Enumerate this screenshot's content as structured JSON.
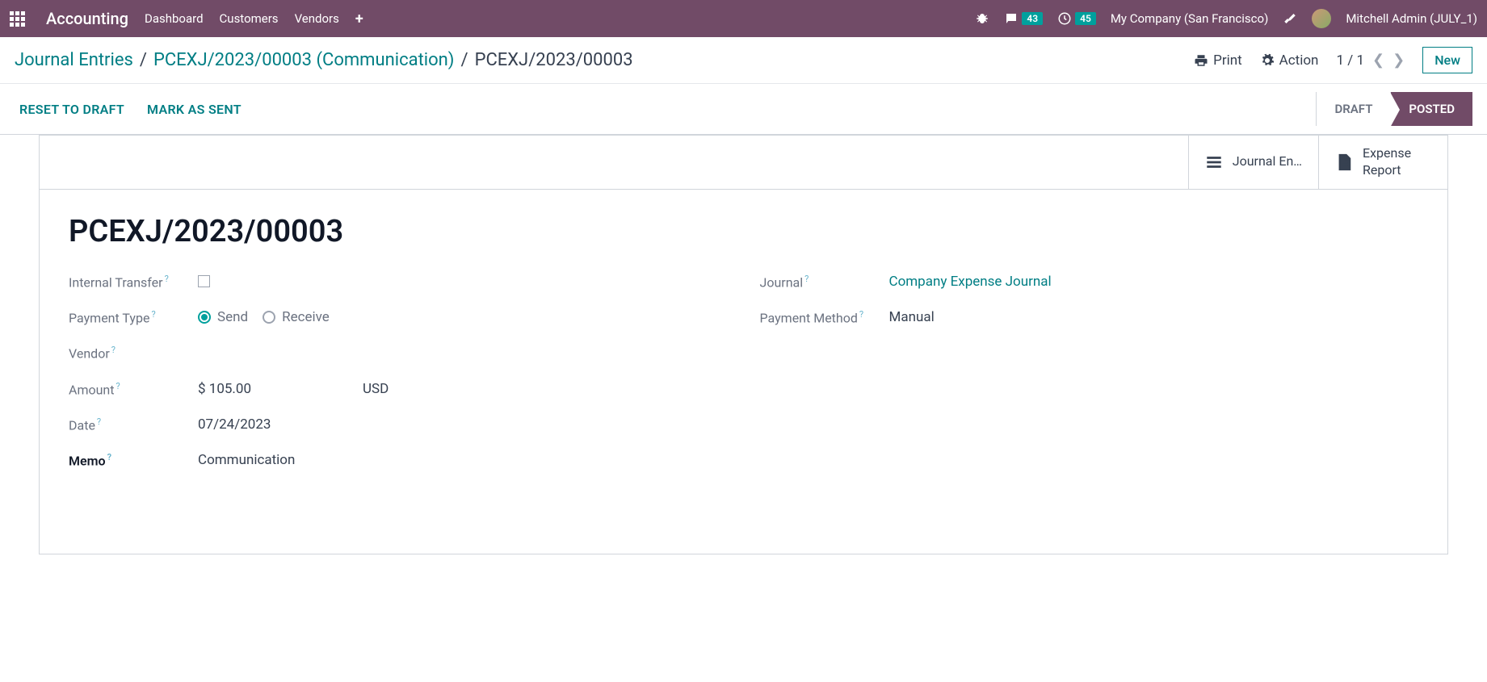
{
  "topnav": {
    "brand": "Accounting",
    "items": [
      "Dashboard",
      "Customers",
      "Vendors"
    ],
    "messages_badge": "43",
    "activities_badge": "45",
    "company": "My Company (San Francisco)",
    "user": "Mitchell Admin (JULY_1)"
  },
  "breadcrumb": {
    "l1": "Journal Entries",
    "l2": "PCEXJ/2023/00003 (Communication)",
    "current": "PCEXJ/2023/00003"
  },
  "controls": {
    "print": "Print",
    "action": "Action",
    "pager": "1 / 1",
    "new": "New"
  },
  "status": {
    "reset": "RESET TO DRAFT",
    "mark_sent": "MARK AS SENT",
    "draft": "DRAFT",
    "posted": "POSTED"
  },
  "stat_buttons": {
    "journal_entry": "Journal En…",
    "expense_report": "Expense Report"
  },
  "record": {
    "name": "PCEXJ/2023/00003",
    "labels": {
      "internal_transfer": "Internal Transfer",
      "payment_type": "Payment Type",
      "vendor": "Vendor",
      "amount": "Amount",
      "date": "Date",
      "memo": "Memo",
      "journal": "Journal",
      "payment_method": "Payment Method"
    },
    "payment_type_send": "Send",
    "payment_type_receive": "Receive",
    "amount": "$ 105.00",
    "currency": "USD",
    "date": "07/24/2023",
    "memo": "Communication",
    "journal": "Company Expense Journal",
    "payment_method": "Manual"
  }
}
